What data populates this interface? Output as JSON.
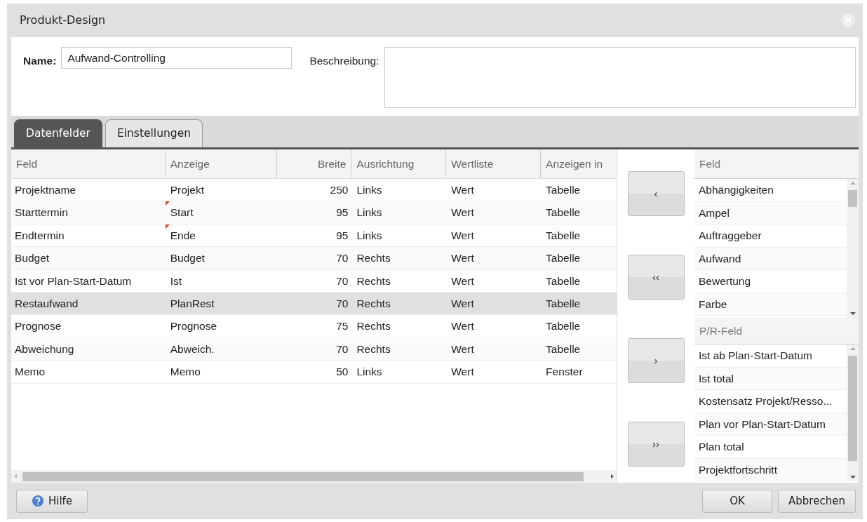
{
  "window": {
    "title": "Produkt-Design"
  },
  "form": {
    "name_label": "Name:",
    "name_value": "Aufwand-Controlling",
    "description_label": "Beschreibung:"
  },
  "tabs": [
    {
      "label": "Datenfelder",
      "selected": true
    },
    {
      "label": "Einstellungen",
      "selected": false
    }
  ],
  "table": {
    "columns": [
      {
        "label": "Feld",
        "kind": "text"
      },
      {
        "label": "Anzeige",
        "kind": "text"
      },
      {
        "label": "Breite",
        "kind": "number"
      },
      {
        "label": "Ausrichtung",
        "kind": "text"
      },
      {
        "label": "Wertliste",
        "kind": "text"
      },
      {
        "label": "Anzeigen in",
        "kind": "text"
      }
    ],
    "rows": [
      {
        "cells": [
          "Projektname",
          "Projekt",
          "250",
          "Links",
          "Wert",
          "Tabelle"
        ],
        "selected": false,
        "marked": false
      },
      {
        "cells": [
          "Starttermin",
          "Start",
          "95",
          "Links",
          "Wert",
          "Tabelle"
        ],
        "selected": false,
        "marked": true
      },
      {
        "cells": [
          "Endtermin",
          "Ende",
          "95",
          "Links",
          "Wert",
          "Tabelle"
        ],
        "selected": false,
        "marked": true
      },
      {
        "cells": [
          "Budget",
          "Budget",
          "70",
          "Rechts",
          "Wert",
          "Tabelle"
        ],
        "selected": false,
        "marked": false
      },
      {
        "cells": [
          "Ist vor Plan-Start-Datum",
          "Ist",
          "70",
          "Rechts",
          "Wert",
          "Tabelle"
        ],
        "selected": false,
        "marked": false
      },
      {
        "cells": [
          "Restaufwand",
          "PlanRest",
          "70",
          "Rechts",
          "Wert",
          "Tabelle"
        ],
        "selected": true,
        "marked": false
      },
      {
        "cells": [
          "Prognose",
          "Prognose",
          "75",
          "Rechts",
          "Wert",
          "Tabelle"
        ],
        "selected": false,
        "marked": false
      },
      {
        "cells": [
          "Abweichung",
          "Abweich.",
          "70",
          "Rechts",
          "Wert",
          "Tabelle"
        ],
        "selected": false,
        "marked": false
      },
      {
        "cells": [
          "Memo",
          "Memo",
          "50",
          "Links",
          "Wert",
          "Fenster"
        ],
        "selected": false,
        "marked": false
      }
    ]
  },
  "transfer_buttons": [
    "‹",
    "‹‹",
    "›",
    "››"
  ],
  "field_lists": [
    {
      "header": "Feld",
      "items": [
        "Abhängigkeiten",
        "Ampel",
        "Auftraggeber",
        "Aufwand",
        "Bewertung",
        "Farbe"
      ]
    },
    {
      "header": "P/R-Feld",
      "items": [
        "Ist ab Plan-Start-Datum",
        "Ist total",
        "Kostensatz Projekt/Resso...",
        "Plan vor Plan-Start-Datum",
        "Plan total",
        "Projektfortschritt"
      ]
    }
  ],
  "footer": {
    "help": "Hilfe",
    "ok": "OK",
    "cancel": "Abbrechen"
  }
}
